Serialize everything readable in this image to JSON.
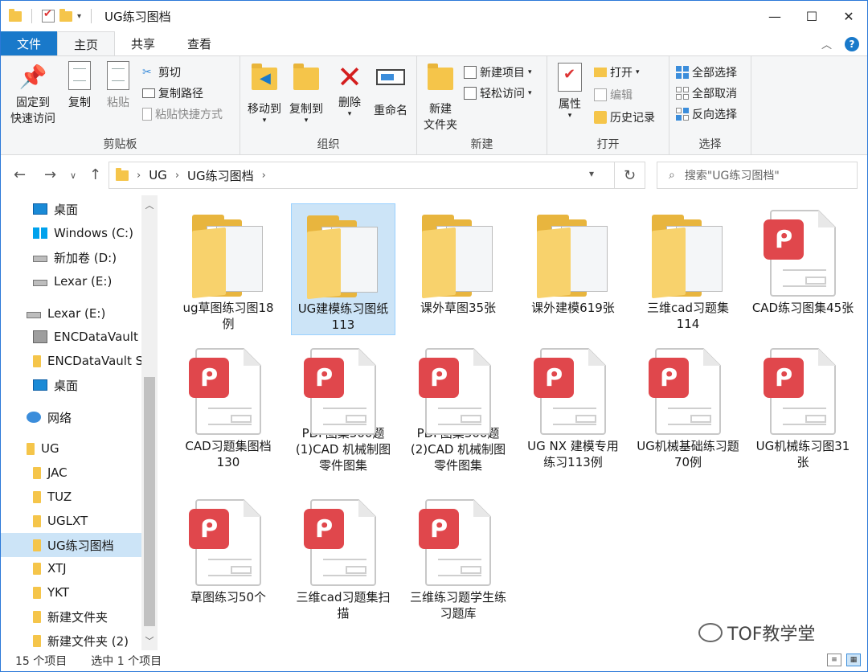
{
  "window": {
    "title": "UG练习图档",
    "minimize": "—",
    "maximize": "☐",
    "close": "✕"
  },
  "tabs": {
    "file": "文件",
    "home": "主页",
    "share": "共享",
    "view": "查看"
  },
  "ribbon": {
    "clipboard": {
      "label": "剪贴板",
      "pin": "固定到\n快速访问",
      "copy": "复制",
      "paste": "粘贴",
      "cut": "剪切",
      "copy_path": "复制路径",
      "paste_shortcut": "粘贴快捷方式"
    },
    "organize": {
      "label": "组织",
      "move_to": "移动到",
      "copy_to": "复制到",
      "delete": "删除",
      "rename": "重命名"
    },
    "new": {
      "label": "新建",
      "new_folder": "新建\n文件夹",
      "new_item": "新建项目",
      "easy_access": "轻松访问"
    },
    "open": {
      "label": "打开",
      "properties": "属性",
      "open": "打开",
      "edit": "编辑",
      "history": "历史记录"
    },
    "select": {
      "label": "选择",
      "select_all": "全部选择",
      "select_none": "全部取消",
      "invert": "反向选择"
    }
  },
  "address": {
    "crumbs": [
      "UG",
      "UG练习图档"
    ],
    "search_placeholder": "搜索\"UG练习图档\""
  },
  "nav": {
    "items": [
      {
        "label": "桌面",
        "icon": "desktop-icon"
      },
      {
        "label": "Windows (C:)",
        "icon": "windows-drive-icon"
      },
      {
        "label": "新加卷 (D:)",
        "icon": "drive-icon"
      },
      {
        "label": "Lexar (E:)",
        "icon": "drive-icon"
      },
      {
        "label": "Lexar (E:)",
        "icon": "drive-icon"
      },
      {
        "label": "ENCDataVault",
        "icon": "vault-icon"
      },
      {
        "label": "ENCDataVault S",
        "icon": "folder-icon"
      },
      {
        "label": "桌面",
        "icon": "desktop-icon"
      },
      {
        "label": "网络",
        "icon": "network-icon"
      },
      {
        "label": "UG",
        "icon": "folder-icon"
      },
      {
        "label": "JAC",
        "icon": "folder-icon"
      },
      {
        "label": "TUZ",
        "icon": "folder-icon"
      },
      {
        "label": "UGLXT",
        "icon": "folder-icon"
      },
      {
        "label": "UG练习图档",
        "icon": "folder-icon"
      },
      {
        "label": "XTJ",
        "icon": "folder-icon"
      },
      {
        "label": "YKT",
        "icon": "folder-icon"
      },
      {
        "label": "新建文件夹",
        "icon": "folder-icon"
      },
      {
        "label": "新建文件夹 (2)",
        "icon": "folder-icon"
      }
    ]
  },
  "files": [
    {
      "name": "ug草图练习图18例",
      "type": "folder"
    },
    {
      "name": "UG建模练习图纸113",
      "type": "folder"
    },
    {
      "name": "课外草图35张",
      "type": "folder"
    },
    {
      "name": "课外建模619张",
      "type": "folder"
    },
    {
      "name": "三维cad习题集114",
      "type": "folder"
    },
    {
      "name": "CAD练习图集45张",
      "type": "pdf"
    },
    {
      "name": "CAD习题集图档130",
      "type": "pdf"
    },
    {
      "name": "PDF图集300题(1)CAD 机械制图零件图集",
      "type": "pdf"
    },
    {
      "name": "PDF图集300题(2)CAD 机械制图零件图集",
      "type": "pdf"
    },
    {
      "name": "UG NX 建模专用练习113例",
      "type": "pdf"
    },
    {
      "name": "UG机械基础练习题70例",
      "type": "pdf"
    },
    {
      "name": "UG机械练习图31张",
      "type": "pdf"
    },
    {
      "name": "草图练习50个",
      "type": "pdf"
    },
    {
      "name": "三维cad习题集扫描",
      "type": "pdf"
    },
    {
      "name": "三维练习题学生练习题库",
      "type": "pdf"
    }
  ],
  "status": {
    "count": "15 个项目",
    "selected": "选中 1 个项目"
  },
  "watermark": "TOF教学堂",
  "colors": {
    "accent": "#1979ca",
    "selection": "#cce4f7",
    "folder": "#f5c54a",
    "pdf": "#e0474c"
  }
}
